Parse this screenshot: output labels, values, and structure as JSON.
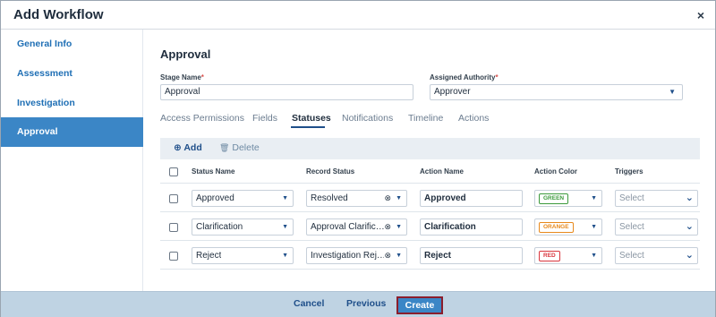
{
  "header": {
    "title": "Add Workflow",
    "close_glyph": "×"
  },
  "sidebar": {
    "items": [
      {
        "label": "General Info"
      },
      {
        "label": "Assessment"
      },
      {
        "label": "Investigation"
      },
      {
        "label": "Approval",
        "active": true
      }
    ]
  },
  "main": {
    "section_title": "Approval",
    "stage_name": {
      "label": "Stage Name",
      "required_mark": "*",
      "value": "Approval"
    },
    "assigned_authority": {
      "label": "Assigned Authority",
      "required_mark": "*",
      "value": "Approver"
    },
    "tabs": [
      "Access Permissions",
      "Fields",
      "Statuses",
      "Notifications",
      "Timeline",
      "Actions"
    ],
    "active_tab": "Statuses"
  },
  "toolbar": {
    "add_label": "Add",
    "add_icon": "⊕",
    "delete_label": "Delete",
    "delete_icon": "🗑"
  },
  "table": {
    "headers": [
      "Status Name",
      "Record Status",
      "Action Name",
      "Action Color",
      "Triggers"
    ],
    "trigger_placeholder": "Select",
    "rows": [
      {
        "status_name": "Approved",
        "record_status": "Resolved",
        "action_name": "Approved",
        "action_color": "GREEN",
        "color_hex": "#3c9a3c"
      },
      {
        "status_name": "Clarification",
        "record_status": "Approval Clarific…",
        "action_name": "Clarification",
        "action_color": "ORANGE",
        "color_hex": "#e8891c"
      },
      {
        "status_name": "Reject",
        "record_status": "Investigation Rej…",
        "action_name": "Reject",
        "action_color": "RED",
        "color_hex": "#d9363e"
      }
    ]
  },
  "footer": {
    "cancel_label": "Cancel",
    "previous_label": "Previous",
    "create_label": "Create"
  },
  "colors": {
    "accent": "#3b86c6",
    "link": "#1f4f8a",
    "footer_bg": "#bfd3e3"
  }
}
